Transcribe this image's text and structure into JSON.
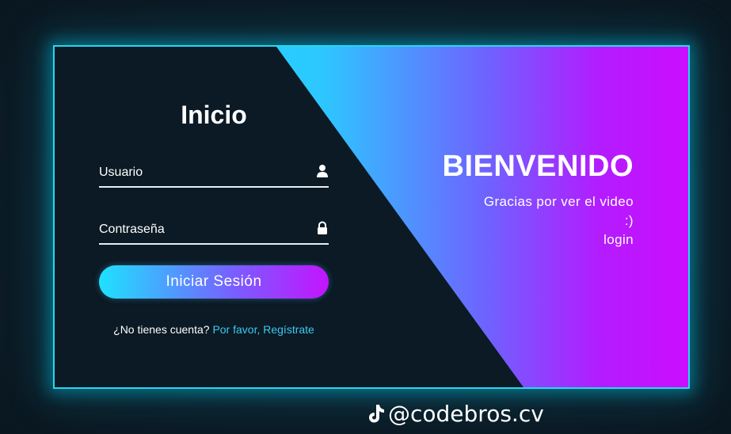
{
  "login": {
    "title": "Inicio",
    "username_placeholder": "Usuario",
    "password_placeholder": "Contraseña",
    "submit_label": "Iniciar Sesión",
    "signup_prompt": "¿No tienes cuenta?",
    "signup_link": "Por favor, Regístrate",
    "icons": {
      "username": "user-icon",
      "password": "lock-icon"
    }
  },
  "welcome": {
    "heading": "BIENVENIDO",
    "line1": "Gracias por ver el video",
    "line2": ":)",
    "line3": "login"
  },
  "footer": {
    "handle": "@codebros.cv",
    "icon": "tiktok-icon"
  },
  "colors": {
    "background": "#0b1a24",
    "border_glow": "#29d6f0",
    "gradient_start": "#15e6ff",
    "gradient_end": "#cc0dff",
    "link": "#3cc8f2"
  }
}
